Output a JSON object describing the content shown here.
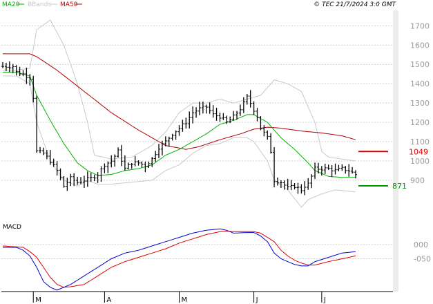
{
  "header": {
    "legend": [
      {
        "label": "MA20",
        "color": "#00b000"
      },
      {
        "label": "BBands",
        "color": "#c8c8c8"
      },
      {
        "label": "MA50",
        "color": "#b00000"
      }
    ],
    "copyright": "© TEC 21/7/2024 3:0 GMT"
  },
  "chart_data": [
    {
      "type": "line",
      "title": "",
      "x_labels": [
        {
          "label": "M",
          "index": 9
        },
        {
          "label": "A",
          "index": 30
        },
        {
          "label": "M",
          "index": 52
        },
        {
          "label": "J",
          "index": 74
        },
        {
          "label": "J",
          "index": 94
        }
      ],
      "yticks": [
        900,
        1000,
        1100,
        1200,
        1300,
        1400,
        1500,
        1600,
        1700
      ],
      "ylim": [
        710,
        1780
      ],
      "grid": true,
      "n_bars": 105,
      "price_anchors": [
        [
          0,
          1490
        ],
        [
          3,
          1490
        ],
        [
          4,
          1460
        ],
        [
          6,
          1450
        ],
        [
          8,
          1430
        ],
        [
          9,
          1330
        ],
        [
          10,
          1050
        ],
        [
          12,
          1040
        ],
        [
          14,
          1000
        ],
        [
          16,
          950
        ],
        [
          18,
          870
        ],
        [
          20,
          910
        ],
        [
          22,
          890
        ],
        [
          24,
          900
        ],
        [
          26,
          910
        ],
        [
          28,
          930
        ],
        [
          30,
          980
        ],
        [
          32,
          1000
        ],
        [
          34,
          1050
        ],
        [
          36,
          960
        ],
        [
          38,
          990
        ],
        [
          40,
          990
        ],
        [
          42,
          975
        ],
        [
          44,
          1010
        ],
        [
          46,
          1070
        ],
        [
          48,
          1100
        ],
        [
          50,
          1140
        ],
        [
          52,
          1170
        ],
        [
          54,
          1200
        ],
        [
          56,
          1250
        ],
        [
          58,
          1270
        ],
        [
          60,
          1280
        ],
        [
          62,
          1240
        ],
        [
          64,
          1230
        ],
        [
          66,
          1200
        ],
        [
          68,
          1230
        ],
        [
          70,
          1270
        ],
        [
          72,
          1330
        ],
        [
          73,
          1300
        ],
        [
          75,
          1230
        ],
        [
          76,
          1170
        ],
        [
          78,
          1120
        ],
        [
          79,
          1050
        ],
        [
          80,
          900
        ],
        [
          82,
          890
        ],
        [
          84,
          860
        ],
        [
          86,
          870
        ],
        [
          88,
          850
        ],
        [
          89,
          870
        ],
        [
          90,
          880
        ],
        [
          92,
          960
        ],
        [
          94,
          960
        ],
        [
          96,
          960
        ],
        [
          98,
          950
        ],
        [
          100,
          960
        ],
        [
          102,
          950
        ],
        [
          104,
          930
        ]
      ],
      "ma20_anchors": [
        [
          0,
          1460
        ],
        [
          4,
          1460
        ],
        [
          8,
          1440
        ],
        [
          10,
          1340
        ],
        [
          14,
          1210
        ],
        [
          18,
          1090
        ],
        [
          22,
          990
        ],
        [
          25,
          950
        ],
        [
          28,
          925
        ],
        [
          32,
          930
        ],
        [
          36,
          950
        ],
        [
          40,
          960
        ],
        [
          44,
          980
        ],
        [
          48,
          1030
        ],
        [
          52,
          1060
        ],
        [
          56,
          1100
        ],
        [
          60,
          1140
        ],
        [
          64,
          1190
        ],
        [
          68,
          1210
        ],
        [
          72,
          1240
        ],
        [
          74,
          1240
        ],
        [
          78,
          1200
        ],
        [
          82,
          1120
        ],
        [
          86,
          1060
        ],
        [
          90,
          990
        ],
        [
          92,
          950
        ],
        [
          96,
          920
        ],
        [
          100,
          915
        ],
        [
          104,
          915
        ]
      ],
      "ma50_anchors": [
        [
          0,
          1555
        ],
        [
          8,
          1555
        ],
        [
          10,
          1540
        ],
        [
          16,
          1470
        ],
        [
          24,
          1360
        ],
        [
          32,
          1250
        ],
        [
          40,
          1160
        ],
        [
          48,
          1080
        ],
        [
          54,
          1060
        ],
        [
          58,
          1075
        ],
        [
          64,
          1110
        ],
        [
          70,
          1140
        ],
        [
          74,
          1165
        ],
        [
          78,
          1175
        ],
        [
          82,
          1170
        ],
        [
          88,
          1155
        ],
        [
          94,
          1145
        ],
        [
          100,
          1130
        ],
        [
          104,
          1110
        ]
      ],
      "bb_upper_anchors": [
        [
          0,
          1470
        ],
        [
          4,
          1470
        ],
        [
          8,
          1480
        ],
        [
          10,
          1680
        ],
        [
          14,
          1730
        ],
        [
          18,
          1600
        ],
        [
          22,
          1400
        ],
        [
          25,
          1200
        ],
        [
          27,
          1030
        ],
        [
          32,
          1010
        ],
        [
          38,
          1020
        ],
        [
          44,
          1080
        ],
        [
          48,
          1150
        ],
        [
          52,
          1250
        ],
        [
          56,
          1300
        ],
        [
          60,
          1300
        ],
        [
          64,
          1320
        ],
        [
          68,
          1300
        ],
        [
          72,
          1320
        ],
        [
          76,
          1340
        ],
        [
          80,
          1420
        ],
        [
          84,
          1400
        ],
        [
          88,
          1360
        ],
        [
          92,
          1200
        ],
        [
          94,
          1050
        ],
        [
          96,
          1020
        ],
        [
          100,
          1010
        ],
        [
          104,
          1000
        ]
      ],
      "bb_lower_anchors": [
        [
          0,
          1440
        ],
        [
          4,
          1440
        ],
        [
          8,
          1400
        ],
        [
          10,
          1200
        ],
        [
          14,
          1000
        ],
        [
          18,
          900
        ],
        [
          22,
          870
        ],
        [
          25,
          900
        ],
        [
          28,
          880
        ],
        [
          32,
          880
        ],
        [
          38,
          890
        ],
        [
          44,
          900
        ],
        [
          48,
          950
        ],
        [
          52,
          980
        ],
        [
          56,
          1040
        ],
        [
          60,
          1080
        ],
        [
          64,
          1090
        ],
        [
          68,
          1120
        ],
        [
          72,
          1120
        ],
        [
          74,
          1100
        ],
        [
          78,
          1000
        ],
        [
          80,
          900
        ],
        [
          84,
          850
        ],
        [
          88,
          760
        ],
        [
          90,
          800
        ],
        [
          94,
          830
        ],
        [
          98,
          850
        ],
        [
          104,
          840
        ]
      ],
      "markers": [
        {
          "label": "1049",
          "value": 1049,
          "color": "#dd0000"
        },
        {
          "label": "871",
          "value": 871,
          "color": "#009900"
        }
      ],
      "series": [
        {
          "name": "MA20",
          "color": "#00b000"
        },
        {
          "name": "BBands",
          "color": "#c8c8c8"
        },
        {
          "name": "MA50",
          "color": "#b00000"
        }
      ]
    },
    {
      "type": "line",
      "title": "MACD",
      "yticks": [
        {
          "label": "000",
          "value": 0
        },
        {
          "label": "-050",
          "value": -50
        }
      ],
      "ylim": [
        -165,
        87
      ],
      "grid": true,
      "macd_anchors": [
        [
          0,
          -10
        ],
        [
          4,
          -10
        ],
        [
          6,
          -20
        ],
        [
          8,
          -40
        ],
        [
          10,
          -80
        ],
        [
          12,
          -130
        ],
        [
          14,
          -150
        ],
        [
          16,
          -160
        ],
        [
          18,
          -150
        ],
        [
          20,
          -140
        ],
        [
          24,
          -110
        ],
        [
          28,
          -80
        ],
        [
          32,
          -50
        ],
        [
          36,
          -30
        ],
        [
          40,
          -20
        ],
        [
          44,
          -5
        ],
        [
          48,
          10
        ],
        [
          52,
          25
        ],
        [
          56,
          40
        ],
        [
          60,
          50
        ],
        [
          64,
          55
        ],
        [
          66,
          50
        ],
        [
          68,
          40
        ],
        [
          72,
          42
        ],
        [
          74,
          42
        ],
        [
          76,
          30
        ],
        [
          78,
          10
        ],
        [
          80,
          -30
        ],
        [
          82,
          -50
        ],
        [
          84,
          -60
        ],
        [
          86,
          -70
        ],
        [
          88,
          -75
        ],
        [
          90,
          -75
        ],
        [
          92,
          -60
        ],
        [
          96,
          -45
        ],
        [
          100,
          -30
        ],
        [
          104,
          -25
        ]
      ],
      "signal_anchors": [
        [
          0,
          -5
        ],
        [
          6,
          -10
        ],
        [
          8,
          -25
        ],
        [
          10,
          -45
        ],
        [
          12,
          -80
        ],
        [
          14,
          -115
        ],
        [
          16,
          -140
        ],
        [
          18,
          -150
        ],
        [
          20,
          -148
        ],
        [
          24,
          -140
        ],
        [
          28,
          -110
        ],
        [
          32,
          -80
        ],
        [
          36,
          -60
        ],
        [
          40,
          -45
        ],
        [
          44,
          -30
        ],
        [
          48,
          -15
        ],
        [
          52,
          5
        ],
        [
          56,
          20
        ],
        [
          60,
          35
        ],
        [
          64,
          45
        ],
        [
          66,
          47
        ],
        [
          68,
          45
        ],
        [
          72,
          45
        ],
        [
          74,
          45
        ],
        [
          76,
          40
        ],
        [
          78,
          25
        ],
        [
          80,
          10
        ],
        [
          82,
          -20
        ],
        [
          84,
          -40
        ],
        [
          86,
          -55
        ],
        [
          88,
          -65
        ],
        [
          90,
          -72
        ],
        [
          92,
          -72
        ],
        [
          96,
          -60
        ],
        [
          100,
          -50
        ],
        [
          104,
          -40
        ]
      ],
      "series": [
        {
          "name": "",
          "color": "#0000cc"
        },
        {
          "name": "",
          "color": "#dd0000"
        }
      ]
    }
  ]
}
